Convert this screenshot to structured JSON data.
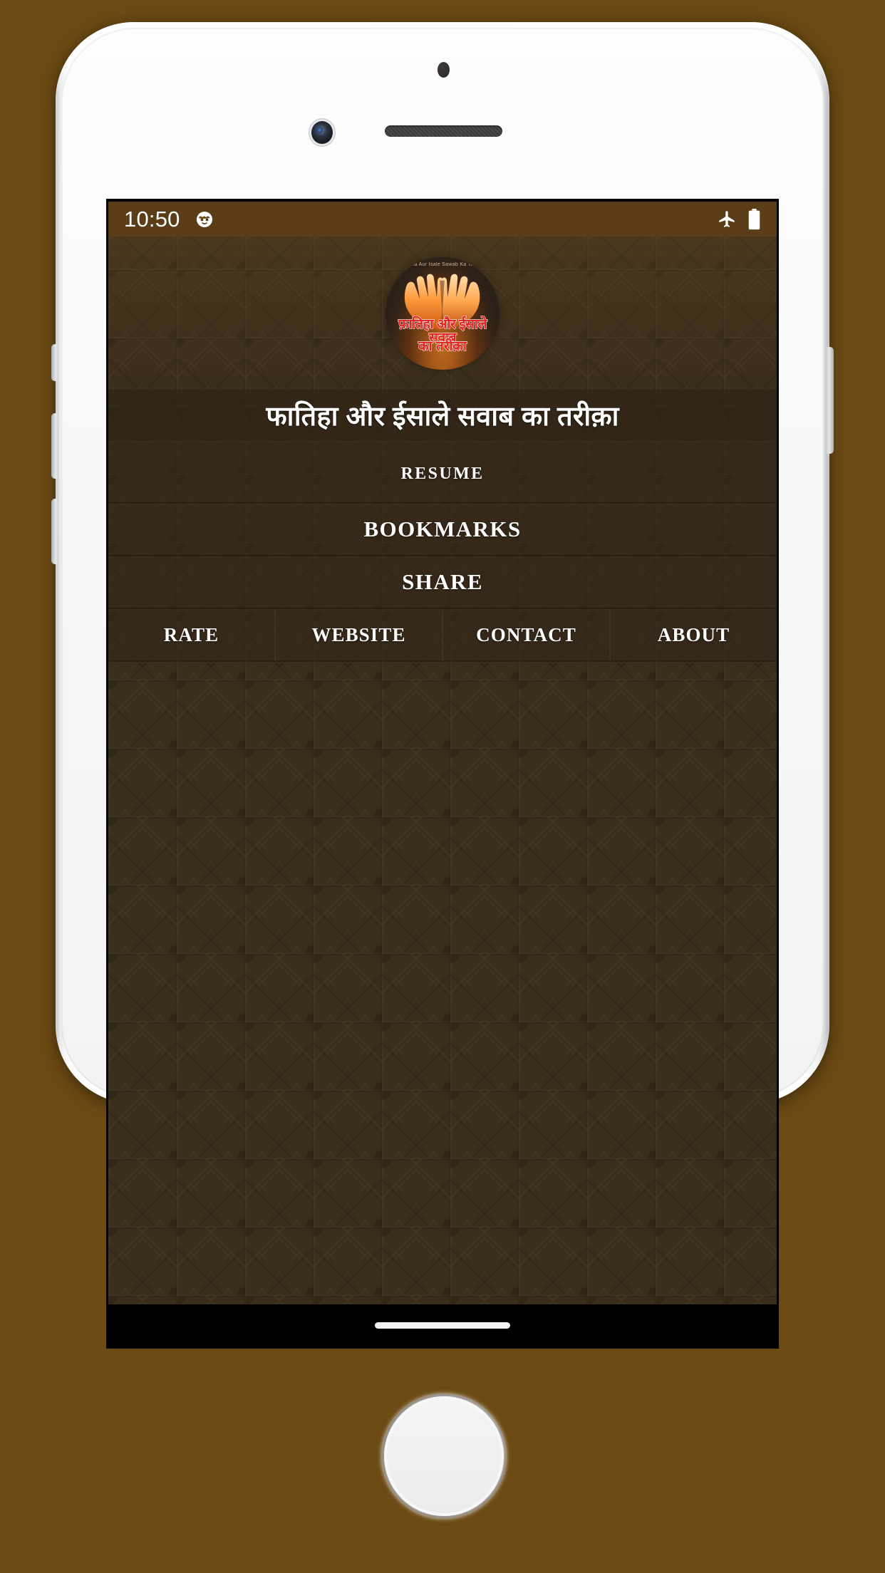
{
  "device": {
    "type": "iphone-white",
    "frame_color": "#ffffff",
    "wallpaper_color": "#6b4a14"
  },
  "status_bar": {
    "time": "10:50",
    "left_icon": "monster-face-icon",
    "right_icons": [
      "airplane-mode-icon",
      "battery-full-icon"
    ],
    "background_color": "#5b3d18",
    "text_color": "#ffffff"
  },
  "header": {
    "logo": {
      "name": "app-logo",
      "top_caption": "Fatiha Aur Isale Sawab Ka Tariqa",
      "text_line_1": "फ़ातिहा और ईसाले सवाब",
      "text_line_2": "का तरीक़ा",
      "text_color": "#e62020",
      "outline_color": "#ffffff",
      "illustration": "praying-hands-icon"
    }
  },
  "app": {
    "title": "फातिहा और ईसाले सवाब का तरीक़ा",
    "theme_color": "#3a2d1b",
    "accent_color": "#5b3d18",
    "pattern": "islamic-geometric-star-pattern"
  },
  "menu": {
    "items": [
      {
        "label": "Resume",
        "name": "resume"
      },
      {
        "label": "BOOKMARKS",
        "name": "bookmarks"
      },
      {
        "label": "SHARE",
        "name": "share"
      }
    ],
    "quick_actions": [
      {
        "label": "RATE",
        "name": "rate"
      },
      {
        "label": "WEBSITE",
        "name": "website"
      },
      {
        "label": "CONTACT",
        "name": "contact"
      },
      {
        "label": "ABOUT",
        "name": "about"
      }
    ]
  },
  "navigation_bar": {
    "indicator": "home-indicator-pill",
    "background_color": "#000000"
  }
}
